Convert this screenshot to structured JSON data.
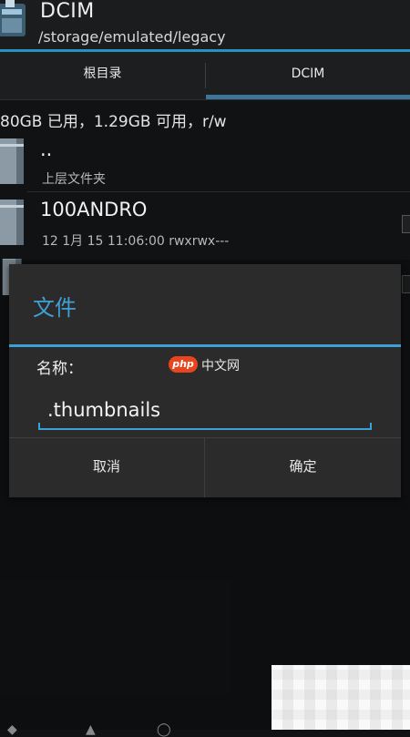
{
  "header": {
    "title": "DCIM",
    "path": "/storage/emulated/legacy"
  },
  "tabs": [
    {
      "label": "根目录",
      "active": false
    },
    {
      "label": "DCIM",
      "active": true
    }
  ],
  "storage_info": "80GB 已用，1.29GB 可用，r/w",
  "list": [
    {
      "name": "..",
      "sub": "上层文件夹"
    },
    {
      "name": "100ANDRO",
      "sub": "12 1月 15 11:06:00   rwxrwx---"
    }
  ],
  "dialog": {
    "title": "文件",
    "name_label": "名称：",
    "input_value": ".thumbnails",
    "cancel_label": "取消",
    "ok_label": "确定"
  },
  "watermark": {
    "badge": "php",
    "text": "中文网"
  },
  "colors": {
    "accent": "#3b9fd8",
    "tab_underline": "#3d7599",
    "background": "#111214",
    "dialog_bg": "#2b2b2b"
  },
  "icons": [
    "folder-icon",
    "app-icon"
  ]
}
